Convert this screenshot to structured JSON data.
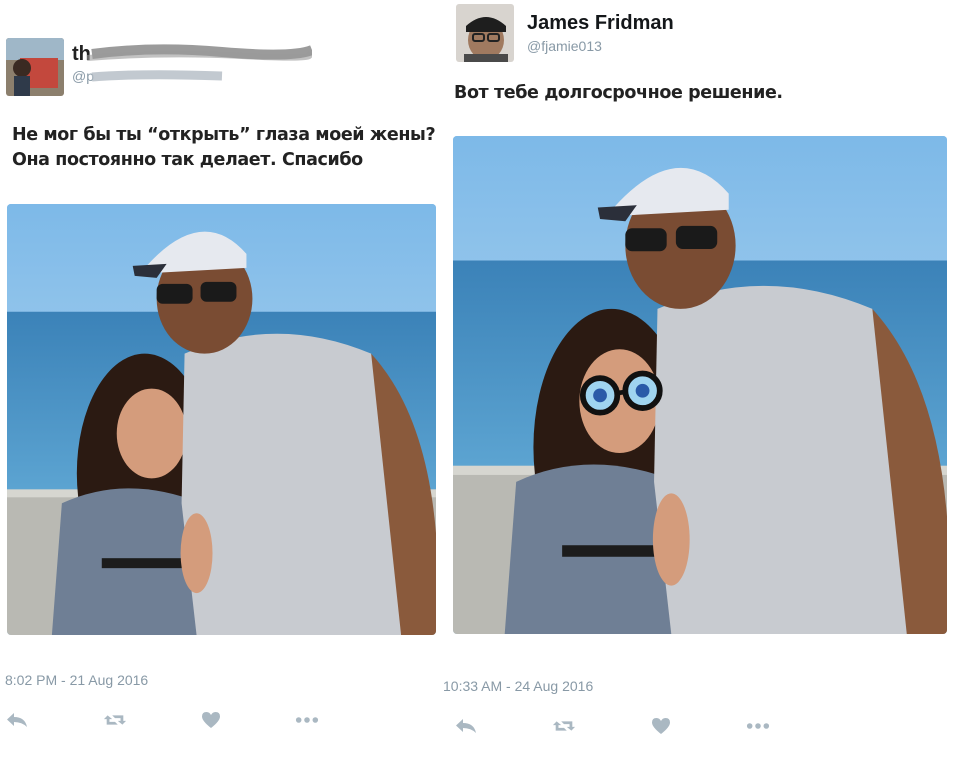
{
  "left_tweet": {
    "text_line1": "Не мог бы ты “открыть” глаза моей жены?",
    "text_line2": "Она постоянно так делает. Спасибо",
    "timestamp": "8:02 PM - 21 Aug 2016"
  },
  "right_tweet": {
    "name": "James Fridman",
    "handle": "@fjamie013",
    "text": "Вот тебе долгосрочное решение.",
    "timestamp": "10:33 AM - 24 Aug 2016"
  },
  "icons": {
    "reply": "reply-icon",
    "retweet": "retweet-icon",
    "like": "heart-icon",
    "more": "more-icon"
  },
  "colors": {
    "name": "#14171a",
    "meta": "#8899a6",
    "action_icon": "#aab8c2",
    "sky": "#8cc3ea",
    "sea": "#3f8fc4"
  }
}
